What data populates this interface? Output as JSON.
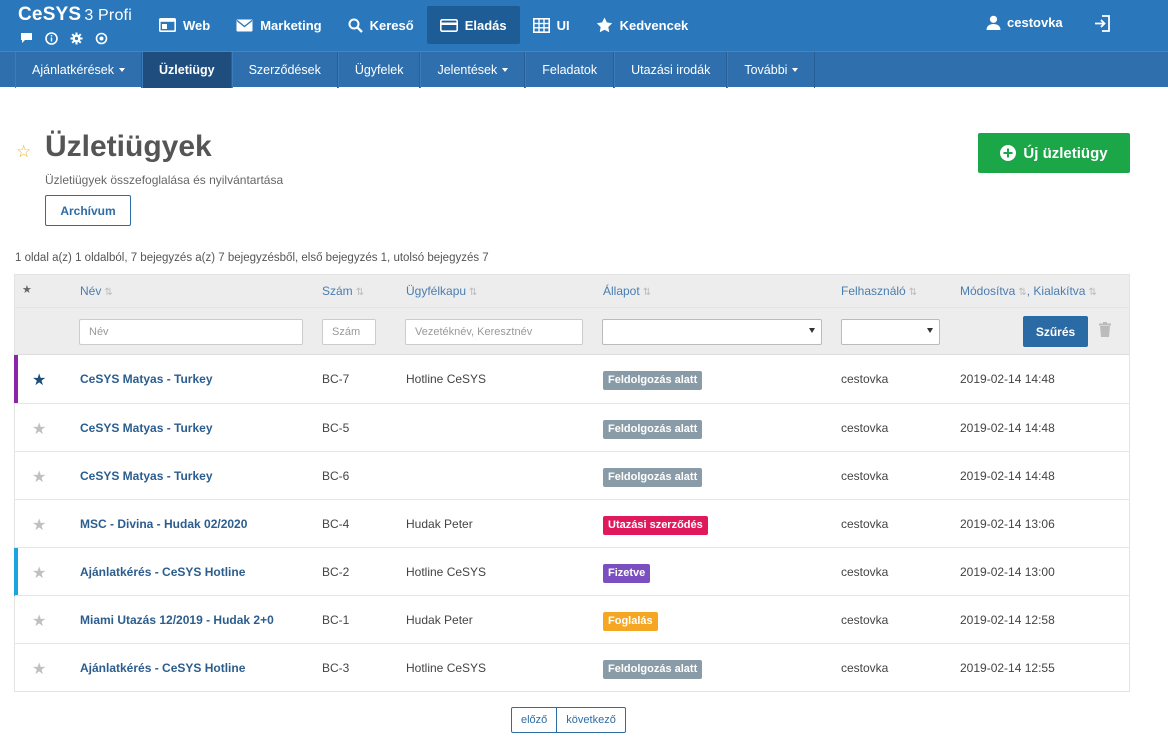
{
  "brand": {
    "name": "CeSYS",
    "suffix": "3 Profi"
  },
  "topnav": [
    {
      "icon": "browser-icon",
      "label": "Web"
    },
    {
      "icon": "envelope-icon",
      "label": "Marketing"
    },
    {
      "icon": "search-icon",
      "label": "Kereső"
    },
    {
      "icon": "credit-card-icon",
      "label": "Eladás",
      "active": true
    },
    {
      "icon": "grid-icon",
      "label": "UI"
    },
    {
      "icon": "star-icon",
      "label": "Kedvencek"
    }
  ],
  "user": {
    "name": "cestovka"
  },
  "subnav": [
    {
      "label": "Ajánlatkérések",
      "caret": true
    },
    {
      "label": "Üzletiügy",
      "active": true
    },
    {
      "label": "Szerződések"
    },
    {
      "label": "Ügyfelek"
    },
    {
      "label": "Jelentések",
      "caret": true
    },
    {
      "label": "Feladatok"
    },
    {
      "label": "Utazási irodák"
    },
    {
      "label": "További",
      "caret": true
    }
  ],
  "page": {
    "title": "Üzletiügyek",
    "subtitle": "Üzletiügyek összefoglalása és nyilvántartása",
    "archive_label": "Archívum",
    "new_label": "Új üzletiügy",
    "summary": "1 oldal a(z) 1 oldalból, 7 bejegyzés a(z) 7 bejegyzésből, első bejegyzés 1, utolsó bejegyzés 7"
  },
  "table": {
    "headers": {
      "star": "★",
      "name": "Név",
      "number": "Szám",
      "client": "Ügyfélkapu",
      "status": "Állapot",
      "user": "Felhasználó",
      "modified": "Módosítva",
      "created": "Kialakítva"
    },
    "filters": {
      "name_placeholder": "Név",
      "number_placeholder": "Szám",
      "client_placeholder": "Vezetéknév, Keresztnév",
      "filter_button": "Szűrés"
    },
    "rows": [
      {
        "starred": true,
        "bar_color": "#8e24aa",
        "name": "CeSYS Matyas - Turkey",
        "number": "BC-7",
        "client": "Hotline CeSYS",
        "status": "Feldolgozás alatt",
        "status_color": "#8a9ba8",
        "user": "cestovka",
        "date": "2019-02-14 14:48"
      },
      {
        "starred": false,
        "bar_color": "",
        "name": "CeSYS Matyas - Turkey",
        "number": "BC-5",
        "client": "",
        "status": "Feldolgozás alatt",
        "status_color": "#8a9ba8",
        "user": "cestovka",
        "date": "2019-02-14 14:48"
      },
      {
        "starred": false,
        "bar_color": "",
        "name": "CeSYS Matyas - Turkey",
        "number": "BC-6",
        "client": "",
        "status": "Feldolgozás alatt",
        "status_color": "#8a9ba8",
        "user": "cestovka",
        "date": "2019-02-14 14:48"
      },
      {
        "starred": false,
        "bar_color": "",
        "name": "MSC - Divina - Hudak 02/2020",
        "number": "BC-4",
        "client": "Hudak Peter",
        "status": "Utazási szerződés",
        "status_color": "#e0195d",
        "user": "cestovka",
        "date": "2019-02-14 13:06"
      },
      {
        "starred": false,
        "bar_color": "#1ca3e0",
        "name": "Ajánlatkérés - CeSYS Hotline",
        "number": "BC-2",
        "client": "Hotline CeSYS",
        "status": "Fizetve",
        "status_color": "#7b4fbf",
        "user": "cestovka",
        "date": "2019-02-14 13:00"
      },
      {
        "starred": false,
        "bar_color": "",
        "name": "Miami Utazás 12/2019 - Hudak 2+0",
        "number": "BC-1",
        "client": "Hudak Peter",
        "status": "Foglalás",
        "status_color": "#f5a623",
        "user": "cestovka",
        "date": "2019-02-14 12:58"
      },
      {
        "starred": false,
        "bar_color": "",
        "name": "Ajánlatkérés - CeSYS Hotline",
        "number": "BC-3",
        "client": "Hotline CeSYS",
        "status": "Feldolgozás alatt",
        "status_color": "#8a9ba8",
        "user": "cestovka",
        "date": "2019-02-14 12:55"
      }
    ]
  },
  "pager": {
    "prev": "előző",
    "next": "következő"
  }
}
